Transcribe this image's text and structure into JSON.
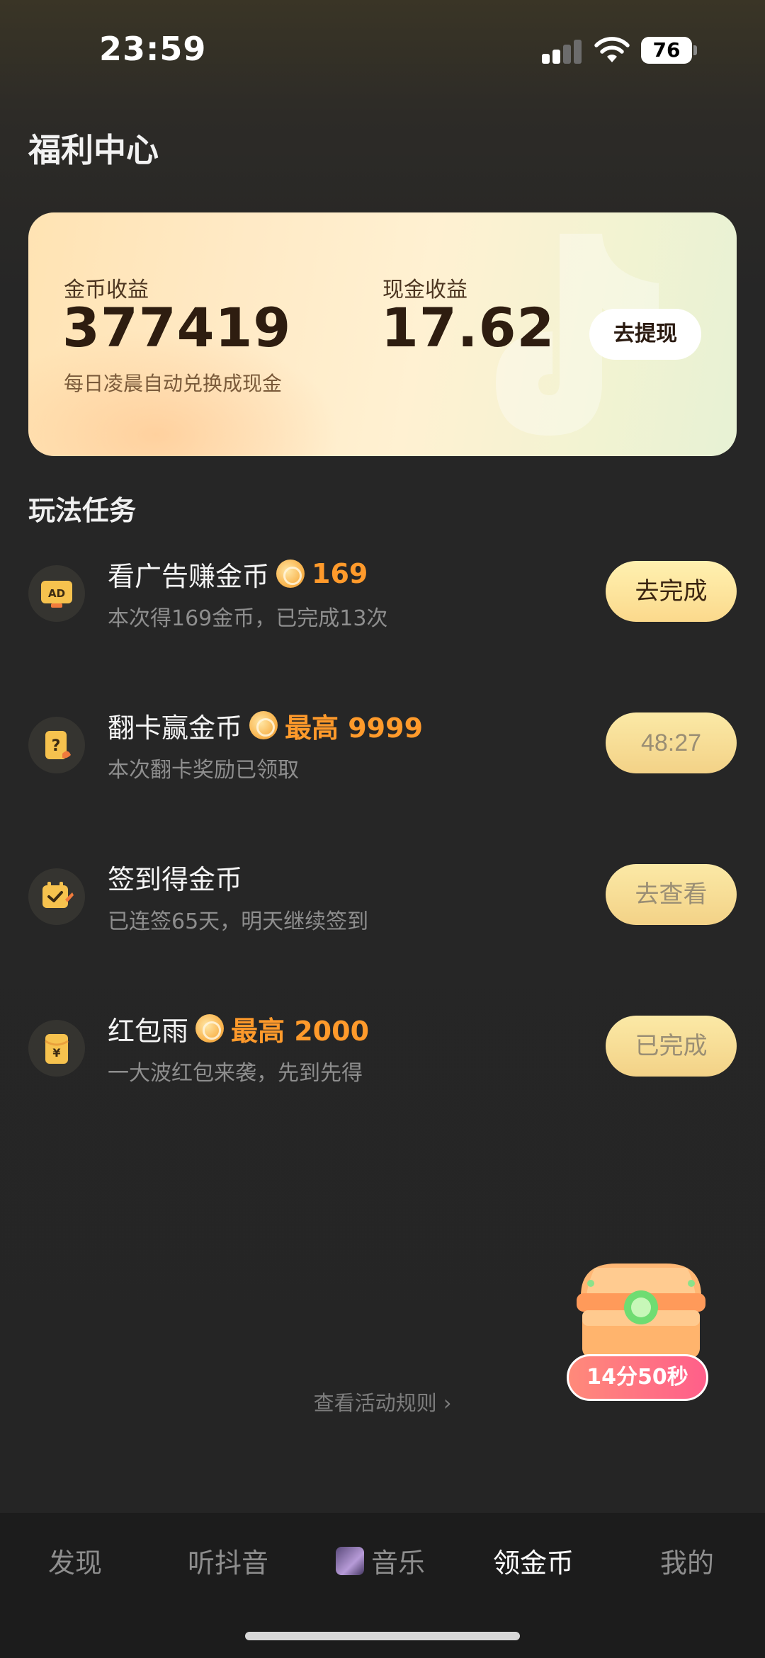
{
  "status_bar": {
    "time": "23:59",
    "battery": "76"
  },
  "page_title": "福利中心",
  "earnings": {
    "coin_label": "金币收益",
    "coin_value": "377419",
    "cash_label": "现金收益",
    "cash_value": "17.62",
    "note": "每日凌晨自动兑换成现金",
    "withdraw_label": "去提现"
  },
  "section_title": "玩法任务",
  "tasks": [
    {
      "title": "看广告赚金币",
      "reward": "169",
      "subtitle": "本次得169金币，已完成13次",
      "button": "去完成",
      "icon": "ad-icon"
    },
    {
      "title": "翻卡赢金币",
      "reward": "最高 9999",
      "subtitle": "本次翻卡奖励已领取",
      "button": "48:27",
      "icon": "card-flip-icon"
    },
    {
      "title": "签到得金币",
      "reward": "",
      "subtitle": "已连签65天，明天继续签到",
      "button": "去查看",
      "icon": "check-in-icon"
    },
    {
      "title": "红包雨",
      "reward": "最高 2000",
      "subtitle": "一大波红包来袭，先到先得",
      "button": "已完成",
      "icon": "red-envelope-icon"
    }
  ],
  "treasure": {
    "timer": "14分50秒"
  },
  "rules_link": "查看活动规则",
  "bottom_nav": [
    {
      "label": "发现"
    },
    {
      "label": "听抖音"
    },
    {
      "label": "音乐"
    },
    {
      "label": "领金币"
    },
    {
      "label": "我的"
    }
  ],
  "colors": {
    "accent": "#ff9a2b",
    "button_gradient_top": "#fff1b0",
    "background": "#252525"
  }
}
